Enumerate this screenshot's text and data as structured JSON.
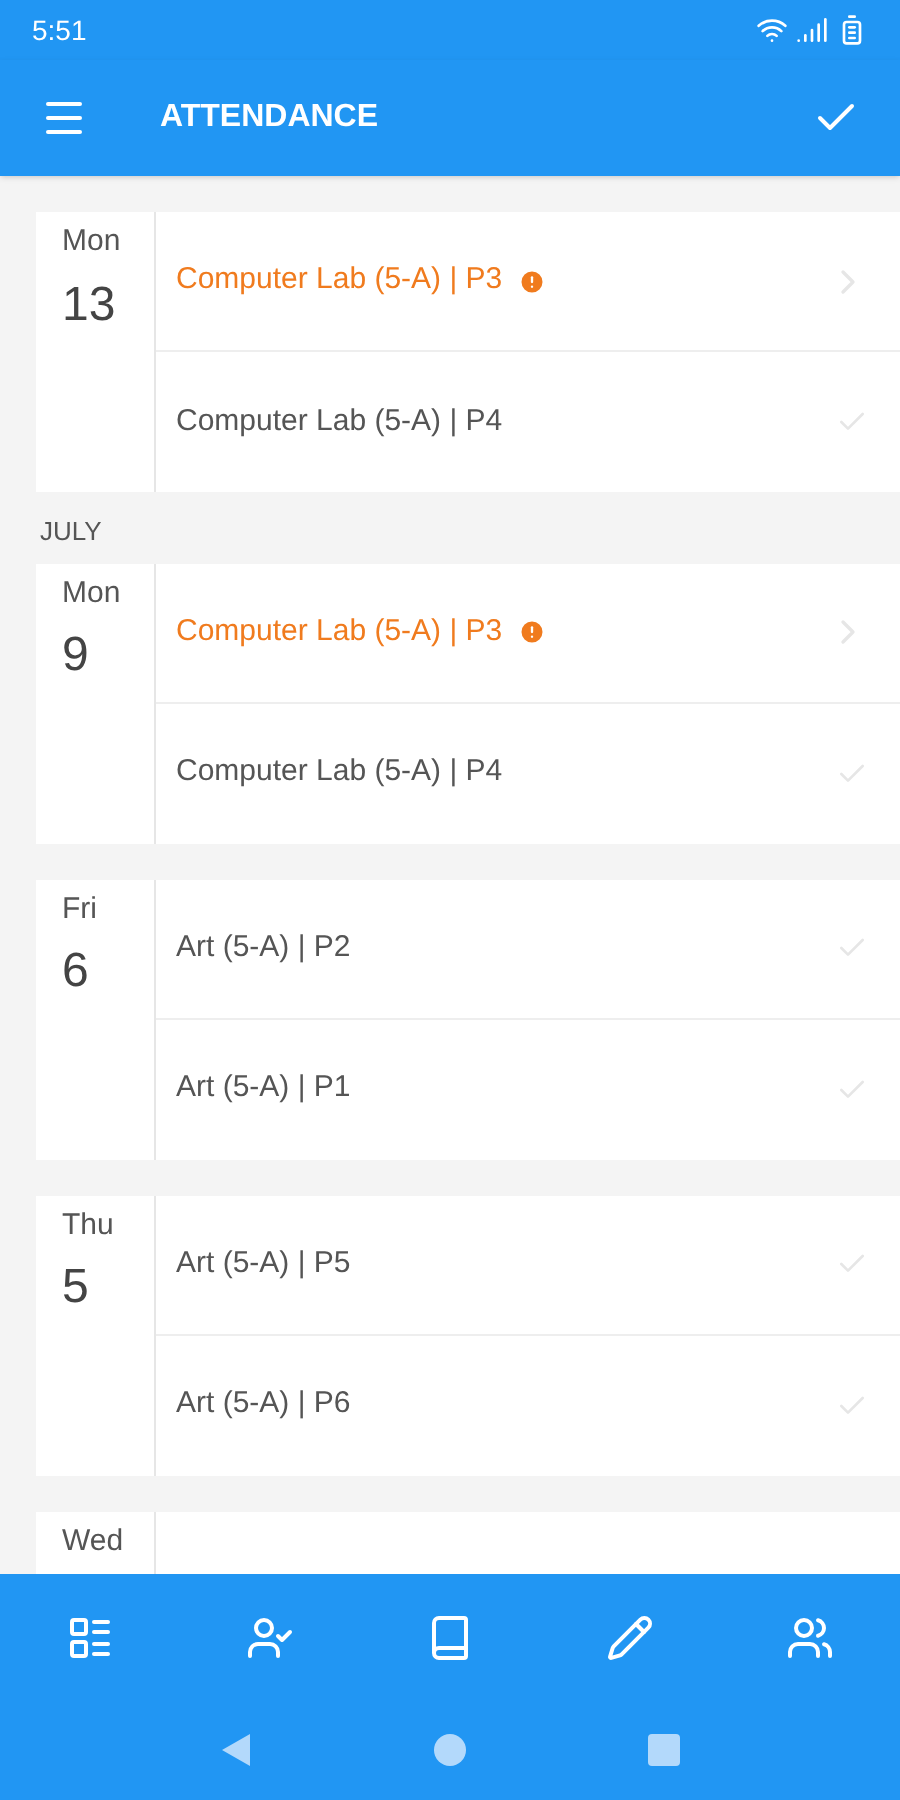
{
  "status_bar": {
    "time": "5:51"
  },
  "app_bar": {
    "title": "ATTENDANCE"
  },
  "groups": [
    {
      "days": [
        {
          "weekday": "Mon",
          "date": "13",
          "lessons": [
            {
              "label": "Computer Lab (5-A) | P3",
              "pending": true
            },
            {
              "label": "Computer Lab (5-A) | P4",
              "pending": false
            }
          ]
        }
      ]
    },
    {
      "month": "JULY",
      "days": [
        {
          "weekday": "Mon",
          "date": "9",
          "lessons": [
            {
              "label": "Computer Lab (5-A) | P3",
              "pending": true
            },
            {
              "label": "Computer Lab (5-A) | P4",
              "pending": false
            }
          ]
        },
        {
          "weekday": "Fri",
          "date": "6",
          "lessons": [
            {
              "label": "Art (5-A) | P2",
              "pending": false
            },
            {
              "label": "Art (5-A) | P1",
              "pending": false
            }
          ]
        },
        {
          "weekday": "Thu",
          "date": "5",
          "lessons": [
            {
              "label": "Art (5-A) | P5",
              "pending": false
            },
            {
              "label": "Art (5-A) | P6",
              "pending": false
            }
          ]
        },
        {
          "weekday": "Wed"
        }
      ]
    }
  ],
  "bottom_nav": [
    {
      "kind": "timetable"
    },
    {
      "kind": "attendance"
    },
    {
      "kind": "notebook"
    },
    {
      "kind": "edit"
    },
    {
      "kind": "groups"
    }
  ]
}
